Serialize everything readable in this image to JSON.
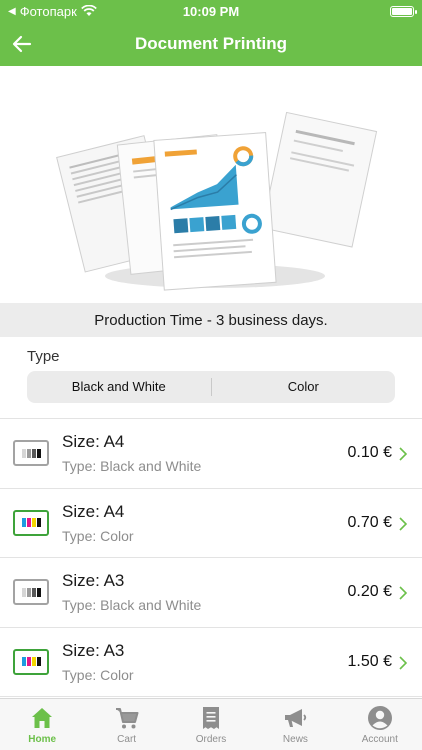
{
  "status": {
    "carrier": "Фотопарк",
    "time": "10:09 PM"
  },
  "nav": {
    "title": "Document Printing"
  },
  "production_time": "Production Time - 3 business days.",
  "type_section": {
    "label": "Type",
    "options": [
      "Black and White",
      "Color"
    ]
  },
  "products": [
    {
      "size": "Size: A4",
      "type": "Type: Black and White",
      "price": "0.10 €",
      "kind": "bw"
    },
    {
      "size": "Size: A4",
      "type": "Type: Color",
      "price": "0.70 €",
      "kind": "color"
    },
    {
      "size": "Size: A3",
      "type": "Type: Black and White",
      "price": "0.20 €",
      "kind": "bw"
    },
    {
      "size": "Size: A3",
      "type": "Type: Color",
      "price": "1.50 €",
      "kind": "color"
    }
  ],
  "tabs": [
    {
      "label": "Home",
      "icon": "home-icon",
      "active": true
    },
    {
      "label": "Cart",
      "icon": "cart-icon",
      "active": false
    },
    {
      "label": "Orders",
      "icon": "receipt-icon",
      "active": false
    },
    {
      "label": "News",
      "icon": "megaphone-icon",
      "active": false
    },
    {
      "label": "Account",
      "icon": "user-icon",
      "active": false
    }
  ],
  "colors": {
    "brand": "#6cc04a",
    "inactive_tab": "#8e8e8e"
  }
}
